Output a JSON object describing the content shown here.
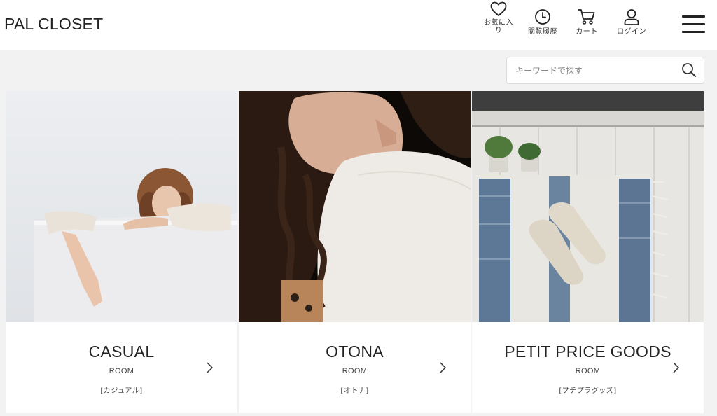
{
  "header": {
    "logo": "PAL CLOSET",
    "nav": {
      "favorites": "お気に入り",
      "history": "閲覧履歴",
      "cart": "カート",
      "login": "ログイン"
    }
  },
  "search": {
    "placeholder": "キーワードで探す"
  },
  "rooms": [
    {
      "title": "CASUAL",
      "subtitle": "ROOM",
      "japanese": "[カジュアル]"
    },
    {
      "title": "OTONA",
      "subtitle": "ROOM",
      "japanese": "[オトナ]"
    },
    {
      "title": "PETIT PRICE GOODS",
      "subtitle": "ROOM",
      "japanese": "[プチプラグッズ]"
    }
  ],
  "icons": {
    "favorites": "heart-icon",
    "history": "clock-icon",
    "cart": "cart-icon",
    "login": "user-icon",
    "menu": "hamburger-menu-icon",
    "search": "search-icon",
    "chevron": "chevron-right-icon"
  }
}
